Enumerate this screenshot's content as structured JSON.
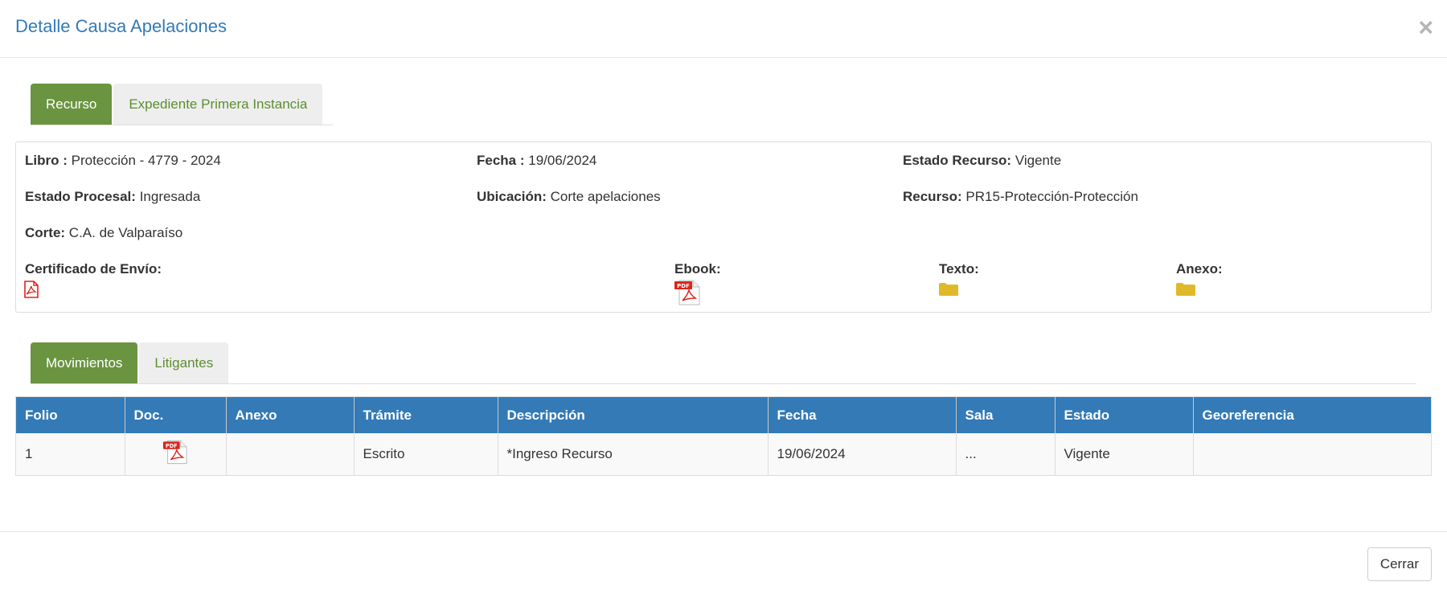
{
  "modal": {
    "title": "Detalle Causa Apelaciones",
    "close_symbol": "×"
  },
  "top_tabs": [
    {
      "label": "Recurso",
      "active": true
    },
    {
      "label": "Expediente Primera Instancia",
      "active": false
    }
  ],
  "recurso": {
    "libro": {
      "label": "Libro :",
      "value": "Protección - 4779 - 2024"
    },
    "fecha": {
      "label": "Fecha :",
      "value": "19/06/2024"
    },
    "estado_recurso": {
      "label": "Estado Recurso:",
      "value": "Vigente"
    },
    "estado_procesal": {
      "label": "Estado Procesal:",
      "value": "Ingresada"
    },
    "ubicacion": {
      "label": "Ubicación:",
      "value": "Corte apelaciones"
    },
    "recurso": {
      "label": "Recurso:",
      "value": "PR15-Protección-Protección"
    },
    "corte": {
      "label": "Corte:",
      "value": "C.A. de Valparaíso"
    },
    "certificado": {
      "label": "Certificado de Envío:",
      "icon": "pdf-outline-icon"
    },
    "ebook": {
      "label": "Ebook:",
      "icon": "pdf-file-icon"
    },
    "texto": {
      "label": "Texto:",
      "icon": "folder-icon"
    },
    "anexo": {
      "label": "Anexo:",
      "icon": "folder-icon"
    }
  },
  "bottom_tabs": [
    {
      "label": "Movimientos",
      "active": true
    },
    {
      "label": "Litigantes",
      "active": false
    }
  ],
  "movimientos": {
    "columns": [
      "Folio",
      "Doc.",
      "Anexo",
      "Trámite",
      "Descripción",
      "Fecha",
      "Sala",
      "Estado",
      "Georeferencia"
    ],
    "rows": [
      {
        "folio": "1",
        "doc_icon": "pdf-file-icon",
        "anexo": "",
        "tramite": "Escrito",
        "descripcion": "*Ingreso Recurso",
        "fecha": "19/06/2024",
        "sala": "...",
        "estado": "Vigente",
        "georeferencia": ""
      }
    ]
  },
  "footer": {
    "close_label": "Cerrar"
  },
  "colors": {
    "title": "#337ab7",
    "tab_active": "#6a9440",
    "tab_inactive_text": "#5b8f2e",
    "table_header": "#337ab7",
    "pdf_red": "#d9261c",
    "folder_yellow": "#e0b92a"
  }
}
